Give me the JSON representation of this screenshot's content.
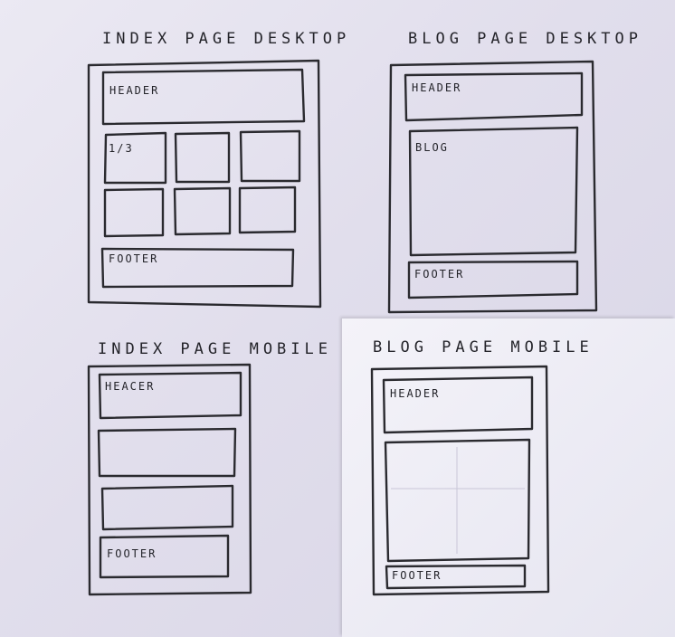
{
  "titles": {
    "index_desktop": "INDEX PAGE DESKTOP",
    "blog_desktop": "BLOG PAGE DESKTOP",
    "index_mobile": "INDEX PAGE MOBILE",
    "blog_mobile": "BLOG PAGE MOBILE"
  },
  "index_desktop": {
    "header": "HEADER",
    "cell_label": "1/3",
    "footer": "FOOTER"
  },
  "blog_desktop": {
    "header": "HEADER",
    "blog": "BLOG",
    "footer": "FOOTER"
  },
  "index_mobile": {
    "header": "HEACER",
    "footer": "FOOTER"
  },
  "blog_mobile": {
    "header": "HEADER",
    "footer": "FOOTER"
  }
}
